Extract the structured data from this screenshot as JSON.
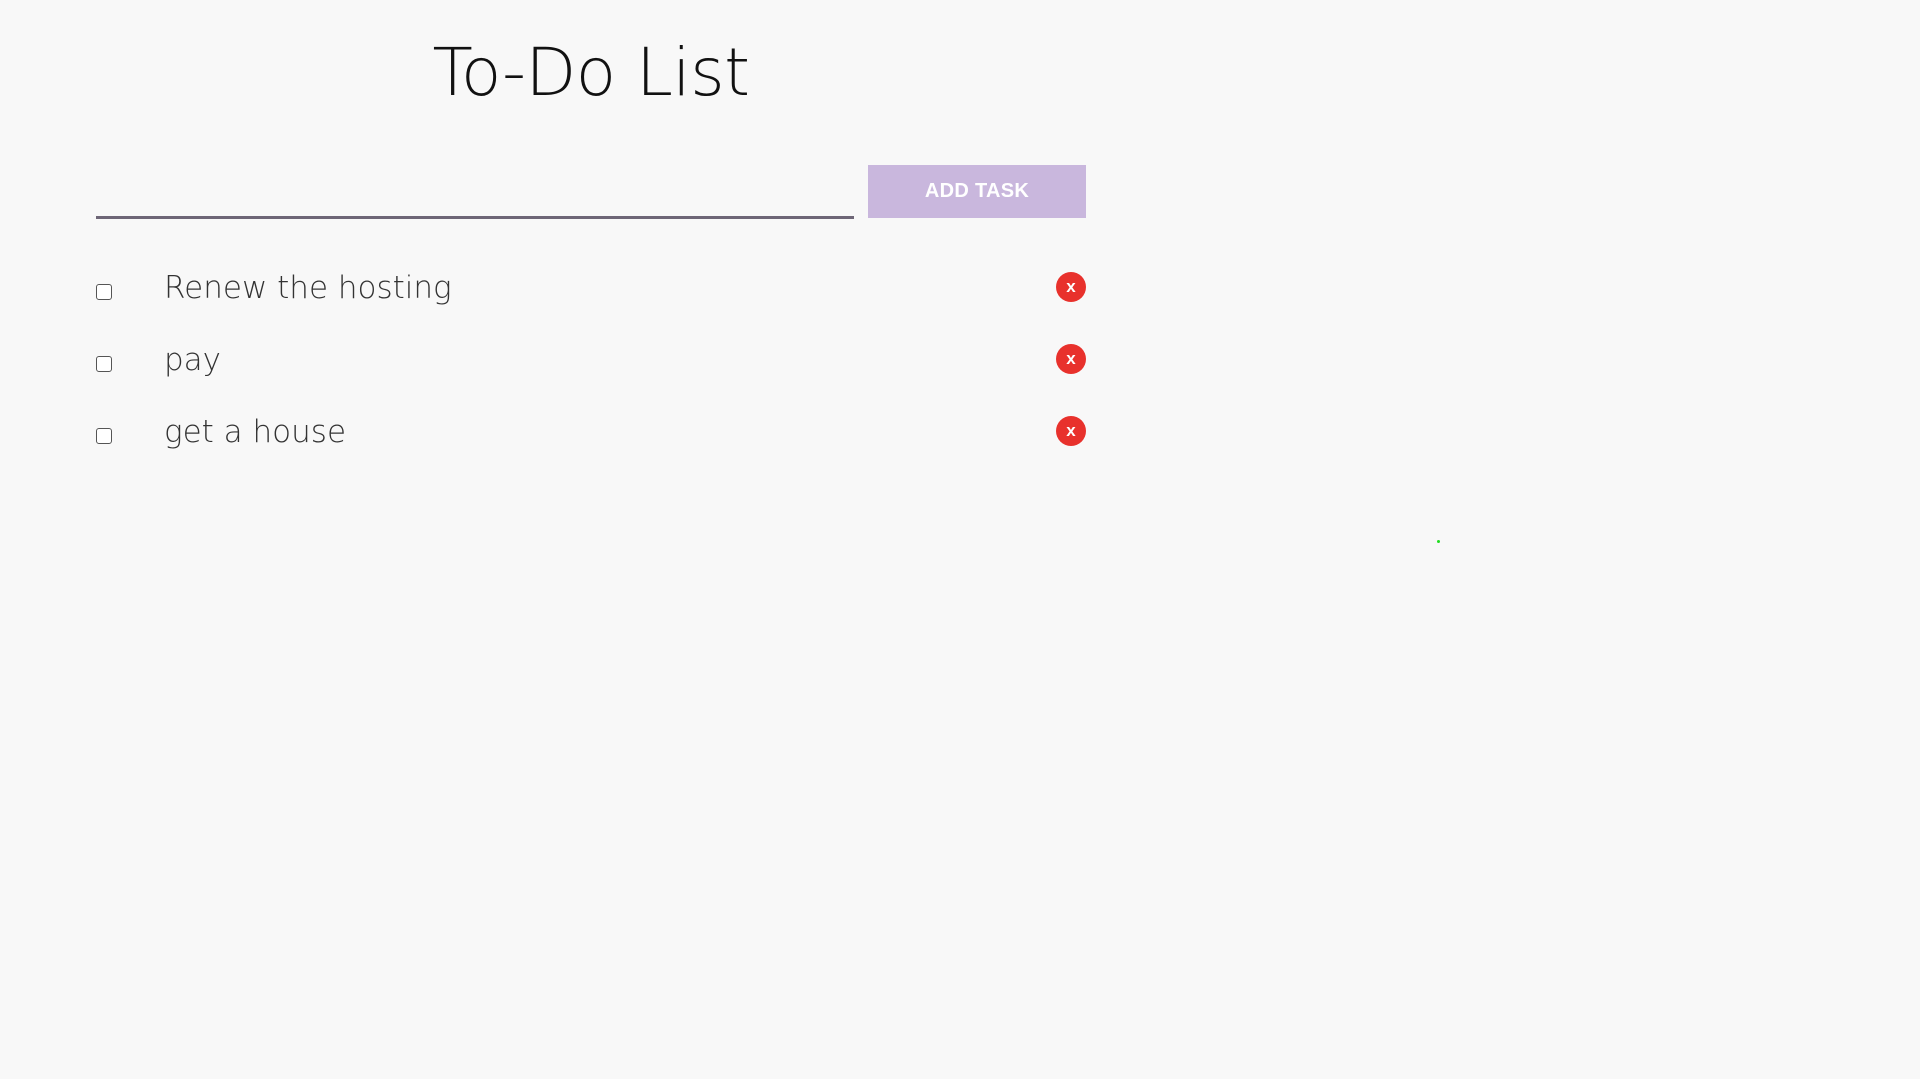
{
  "app": {
    "title": "To-Do List"
  },
  "new_task": {
    "value": "",
    "placeholder": "",
    "add_button_label": "ADD TASK"
  },
  "tasks": [
    {
      "label": "Renew the hosting",
      "checked": false,
      "delete_label": "x"
    },
    {
      "label": "pay",
      "checked": false,
      "delete_label": "x"
    },
    {
      "label": "get a house",
      "checked": false,
      "delete_label": "x"
    }
  ],
  "colors": {
    "background": "#f8f8f8",
    "add_button": "#c9b7dd",
    "delete_button": "#e8312c",
    "input_underline": "#6e6677"
  },
  "icons": {
    "delete": "close-icon"
  }
}
